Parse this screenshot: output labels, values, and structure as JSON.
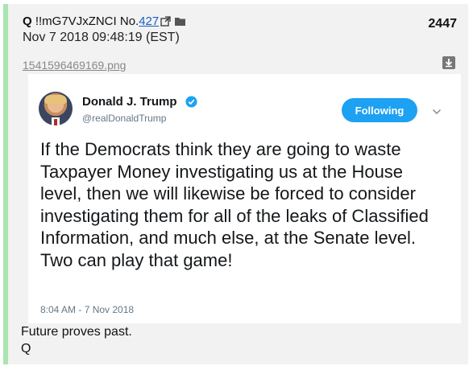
{
  "post": {
    "author": "Q",
    "tripcode": "!!mG7VJxZNCI",
    "no_label": "No.",
    "no_value": "427",
    "post_number": "2447",
    "datetime": "Nov 7 2018 09:48:19 (EST)",
    "filename": "1541596469169.png"
  },
  "tweet": {
    "display_name": "Donald J. Trump",
    "handle": "@realDonaldTrump",
    "follow_label": "Following",
    "text": "If the Democrats think they are going to waste Taxpayer Money investigating us at the House level, then we will likewise be forced to consider investigating them for all of the leaks of Classified Information, and much else, at the Senate level. Two can play that game!",
    "timestamp": "8:04 AM - 7 Nov 2018"
  },
  "comment": {
    "line1": "Future proves past.",
    "line2": "Q"
  },
  "colors": {
    "accent_bar": "#a8e6b0",
    "link": "#1a5fc2",
    "twitter_blue": "#1da1f2"
  }
}
